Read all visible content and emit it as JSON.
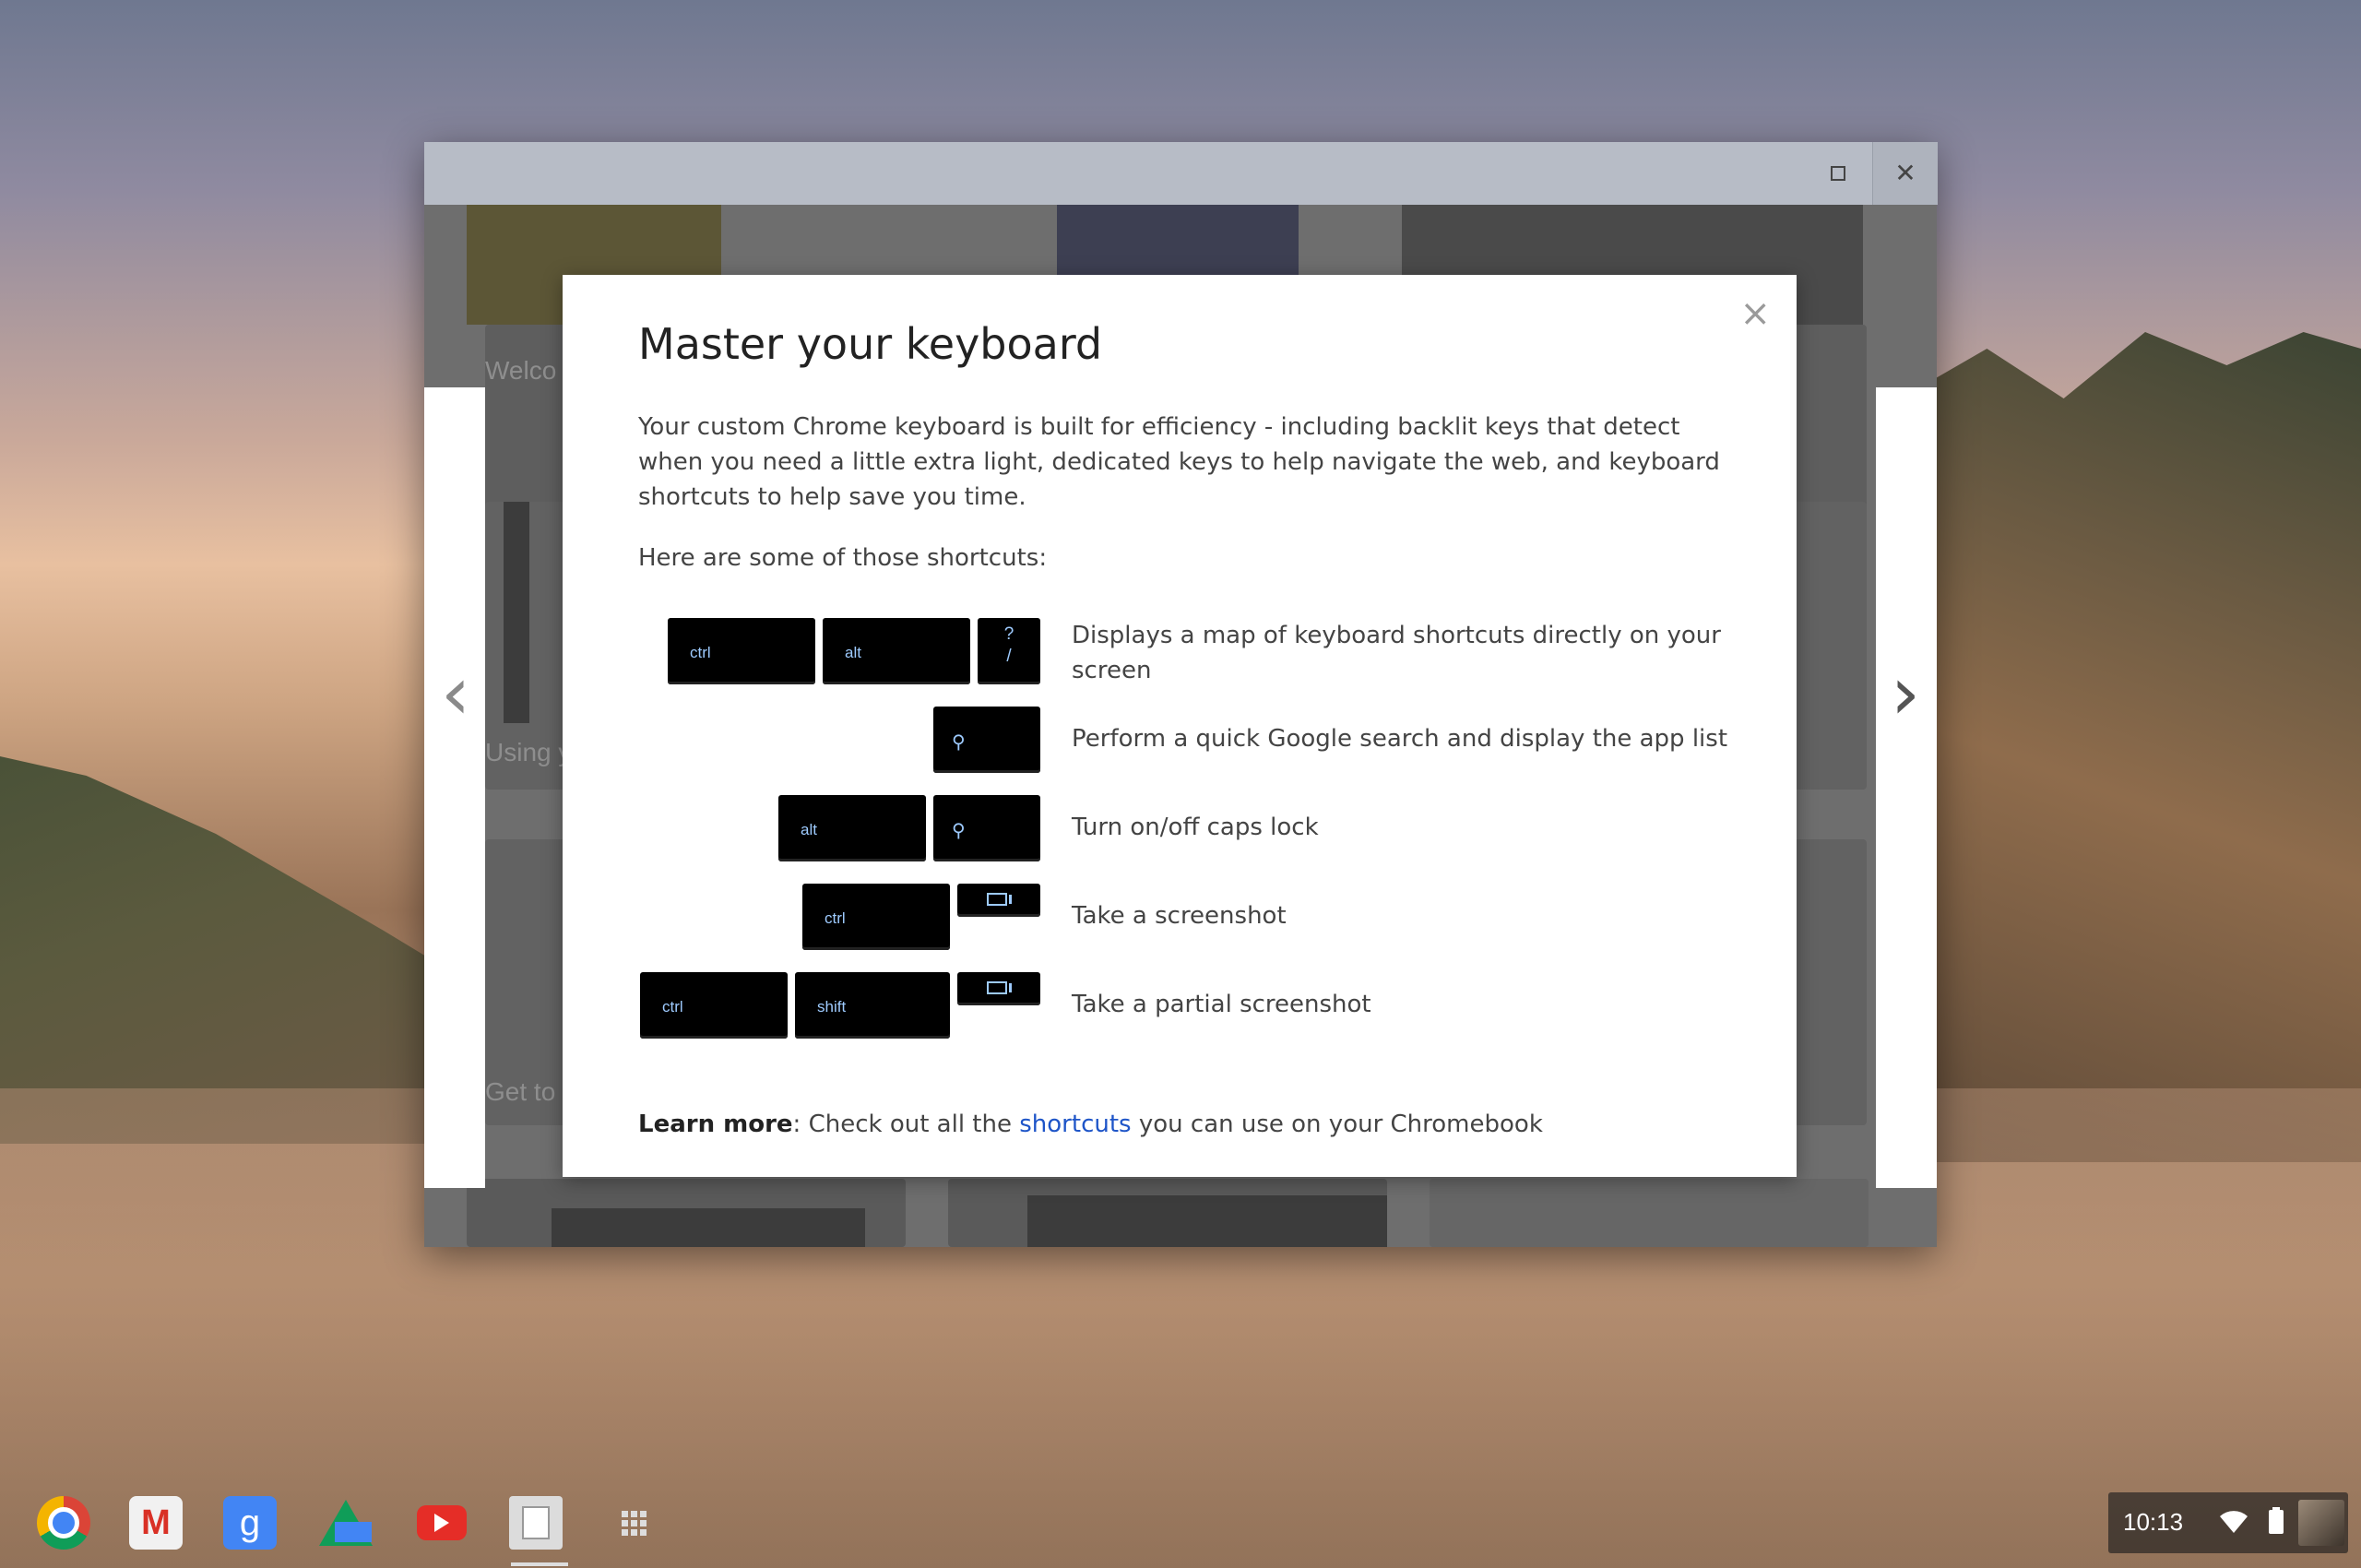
{
  "dialog": {
    "title": "Master your keyboard",
    "close_label": "×",
    "intro": "Your custom Chrome keyboard is built for efficiency - including backlit keys that detect when you need a little extra light, dedicated keys to help navigate the web, and keyboard shortcuts to help save you time.",
    "shortcuts_heading": "Here are some of those shortcuts:",
    "shortcuts": [
      {
        "keys": [
          "ctrl",
          "alt",
          "?\n/"
        ],
        "description": "Displays a map of keyboard shortcuts directly on your screen"
      },
      {
        "keys": [
          "search-icon"
        ],
        "description": "Perform a quick Google search and display the app list"
      },
      {
        "keys": [
          "alt",
          "search-icon"
        ],
        "description": "Turn on/off caps lock"
      },
      {
        "keys": [
          "ctrl",
          "window-switcher-icon"
        ],
        "description": "Take a screenshot"
      },
      {
        "keys": [
          "ctrl",
          "shift",
          "window-switcher-icon"
        ],
        "description": "Take a partial screenshot"
      }
    ],
    "key_labels": {
      "ctrl": "ctrl",
      "alt": "alt",
      "shift": "shift",
      "question_top": "?",
      "question_bottom": "/"
    },
    "learn_more": {
      "bold": "Learn more",
      "prefix": ": Check out all the ",
      "link": "shortcuts",
      "suffix": " you can use on your Chromebook"
    }
  },
  "background_cards": {
    "texts": [
      "Welco",
      "Using y",
      "Get to"
    ]
  },
  "window": {
    "maximize_icon": "maximize-icon",
    "close_icon": "close-icon",
    "close_glyph": "✕"
  },
  "navigation": {
    "prev": "‹",
    "next": "›"
  },
  "shelf": {
    "apps": [
      "chrome-icon",
      "gmail-icon",
      "google-search-icon",
      "drive-icon",
      "youtube-icon",
      "files-icon",
      "app-launcher-icon"
    ],
    "gmail_glyph": "M",
    "google_glyph": "g"
  },
  "tray": {
    "time": "10:13"
  },
  "colors": {
    "key_text": "#9ecbff",
    "link": "#1e55c8",
    "tray_bg": "#1e1e1e"
  }
}
